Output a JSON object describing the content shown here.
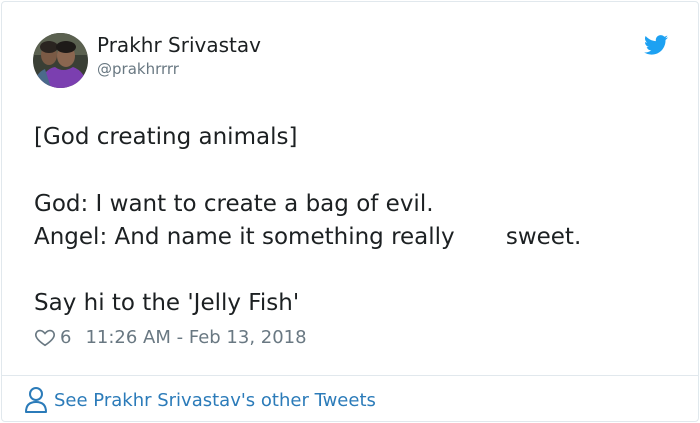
{
  "author": {
    "name": "Prakhr Srivastav",
    "handle": "@prakhrrrr"
  },
  "tweet": {
    "lines": [
      "[God creating animals]",
      "God: I want to create a bag of evil.",
      "Angel: And name it something really       sweet.",
      "Say hi to the 'Jelly Fish'"
    ],
    "likes": "6",
    "timestamp": "11:26 AM - Feb 13, 2018"
  },
  "footer": {
    "link_label": "See Prakhr Srivastav's other Tweets"
  },
  "colors": {
    "twitter_blue": "#1da1f2",
    "link_blue": "#2b7bb9",
    "text": "#1c2022",
    "muted": "#697882",
    "border": "#e1e8ed"
  },
  "icons": {
    "brand": "twitter-bird-icon",
    "like": "heart-icon",
    "profile": "person-icon"
  }
}
